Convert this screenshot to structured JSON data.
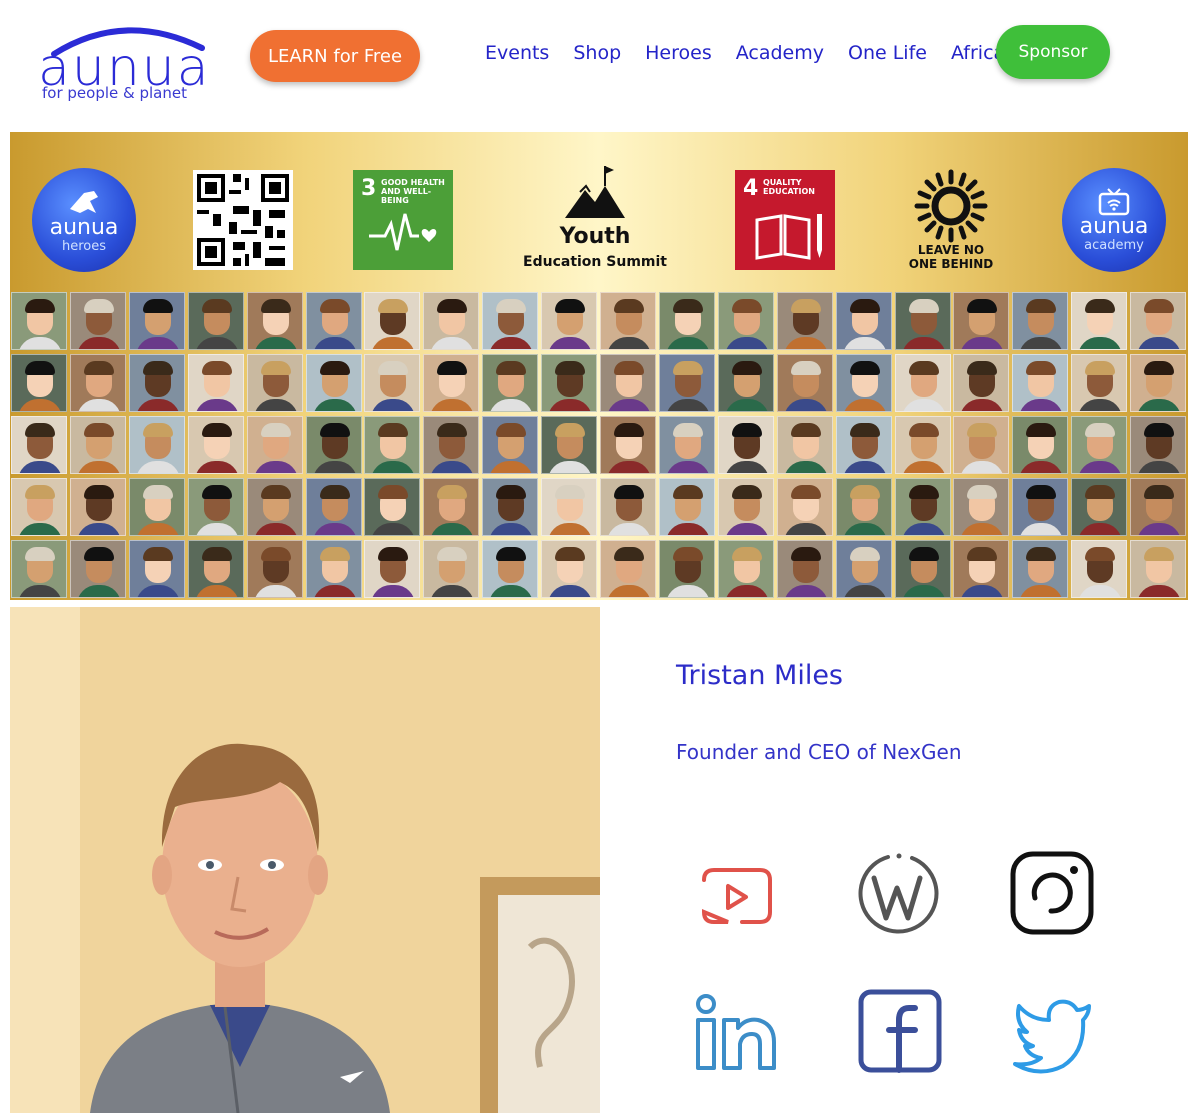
{
  "header": {
    "logo_word": "aunua",
    "logo_tagline": "for people & planet",
    "learn_button": "LEARN for Free",
    "nav": [
      "Events",
      "Shop",
      "Heroes",
      "Academy",
      "One Life",
      "Africa"
    ],
    "sponsor_button": "Sponsor"
  },
  "banner": {
    "left_logo": {
      "word": "aunua",
      "sub": "heroes"
    },
    "right_logo": {
      "word": "aunua",
      "sub": "academy"
    },
    "sdg3": {
      "number": "3",
      "title": "GOOD HEALTH AND WELL-BEING"
    },
    "sdg4": {
      "number": "4",
      "title": "QUALITY EDUCATION"
    },
    "summit_title": "Youth",
    "summit_subtitle": "Education Summit",
    "lnob_text": "LEAVE NO ONE BEHIND"
  },
  "profile": {
    "name": "Tristan Miles",
    "role": "Founder and CEO of NexGen"
  },
  "social": [
    {
      "icon": "youtube-icon",
      "color": "#e0524a"
    },
    {
      "icon": "wordpress-icon",
      "color": "#555555"
    },
    {
      "icon": "instagram-icon",
      "color": "#111111"
    },
    {
      "icon": "linkedin-icon",
      "color": "#3c8dc8"
    },
    {
      "icon": "facebook-icon",
      "color": "#3b4f9a"
    },
    {
      "icon": "twitter-icon",
      "color": "#2e9be6"
    }
  ]
}
